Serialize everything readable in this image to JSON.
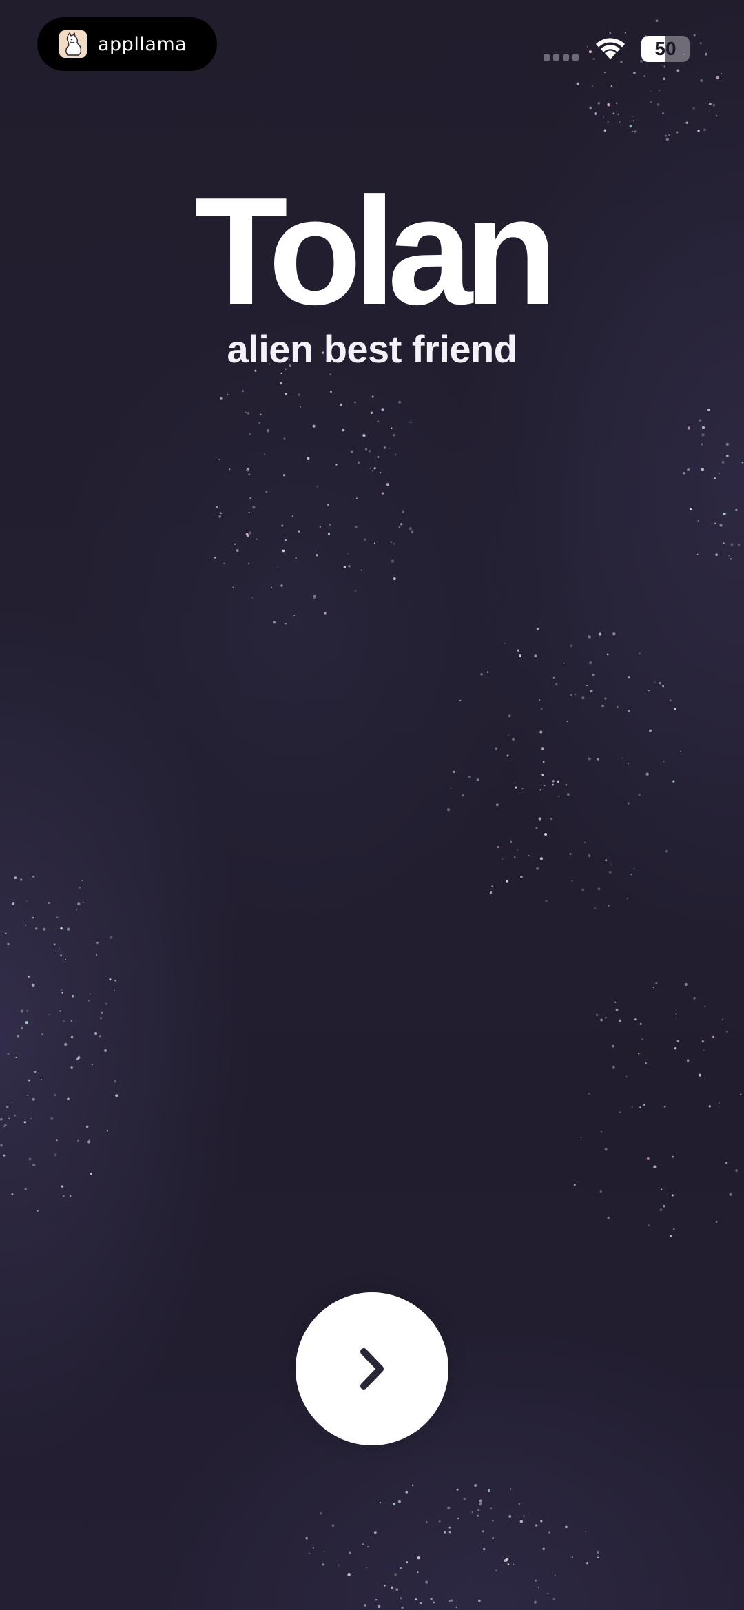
{
  "status_bar": {
    "app_name": "appllama",
    "battery_level": "50",
    "battery_fraction": 0.5
  },
  "main": {
    "title": "Tolan",
    "subtitle": "alien best friend"
  },
  "icons": {
    "app_logo": "llama-logo-icon",
    "signal": "cellular-signal-icon",
    "wifi": "wifi-icon",
    "next": "chevron-right-icon"
  },
  "colors": {
    "background": "#211d2d",
    "text": "#ffffff",
    "button": "#ffffff",
    "chevron": "#2a2635",
    "logo_bg": "#f2dcc3"
  }
}
